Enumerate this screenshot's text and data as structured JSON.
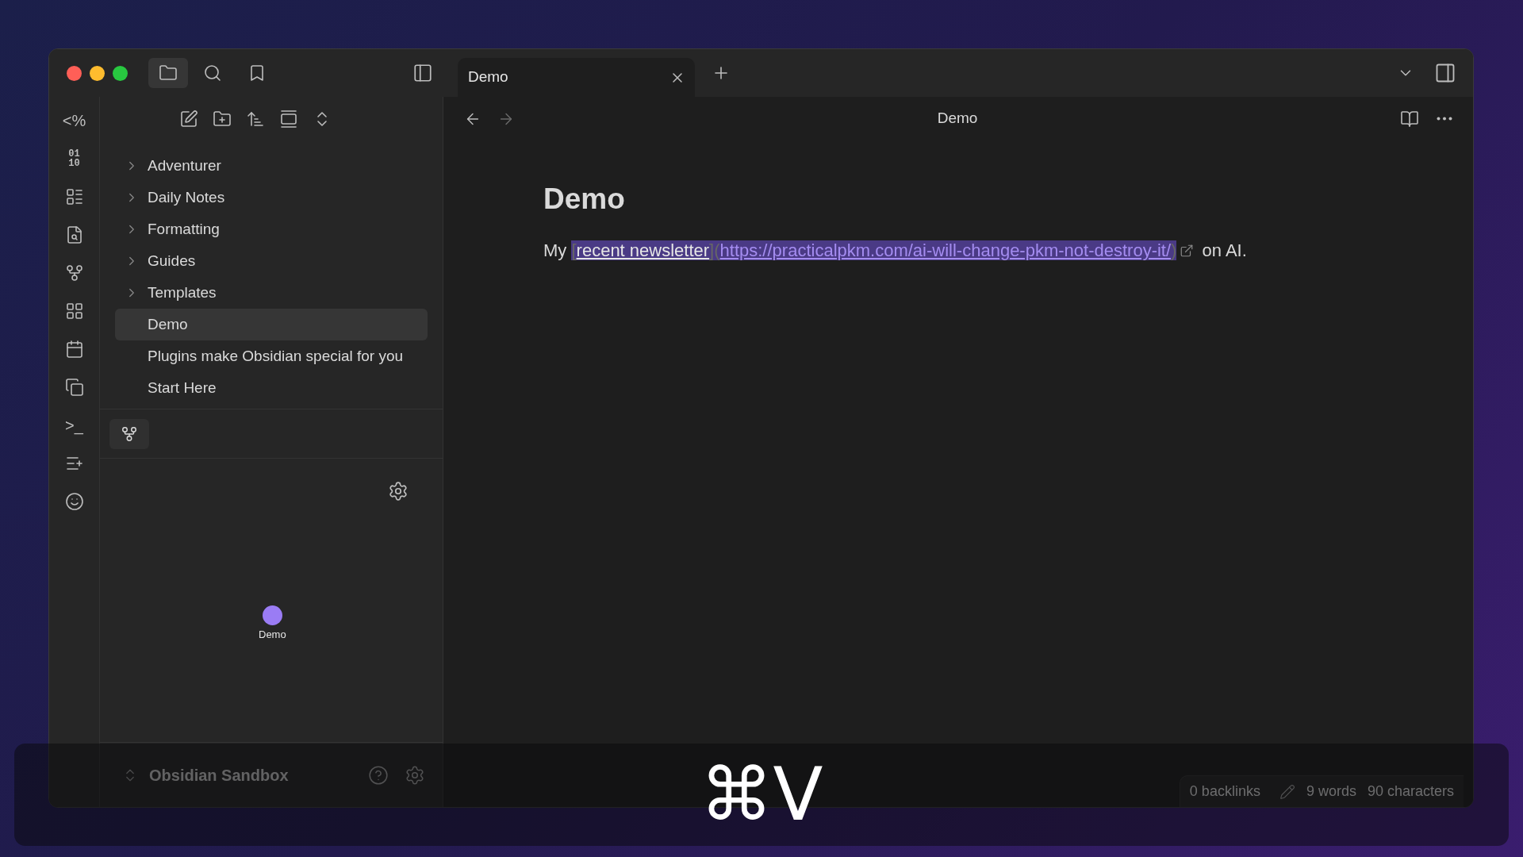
{
  "titlebar": {
    "nav_tabs": [
      {
        "kind": "files",
        "selected": true
      },
      {
        "kind": "search",
        "selected": false
      },
      {
        "kind": "bookmarks",
        "selected": false
      }
    ],
    "tabs": [
      {
        "label": "Demo",
        "selected": true
      }
    ]
  },
  "ribbon": [
    {
      "kind": "text",
      "text": "<%"
    },
    {
      "kind": "text",
      "lines": [
        "01",
        "10"
      ]
    },
    {
      "kind": "list"
    },
    {
      "kind": "doc-search"
    },
    {
      "kind": "graph"
    },
    {
      "kind": "grid"
    },
    {
      "kind": "calendar"
    },
    {
      "kind": "copy"
    },
    {
      "kind": "text",
      "text": ">_"
    },
    {
      "kind": "stack-add"
    },
    {
      "kind": "smile"
    }
  ],
  "file_tree": [
    {
      "label": "Adventurer",
      "kind": "folder",
      "selected": false
    },
    {
      "label": "Daily Notes",
      "kind": "folder",
      "selected": false
    },
    {
      "label": "Formatting",
      "kind": "folder",
      "selected": false
    },
    {
      "label": "Guides",
      "kind": "folder",
      "selected": false
    },
    {
      "label": "Templates",
      "kind": "folder",
      "selected": false
    },
    {
      "label": "Demo",
      "kind": "file",
      "selected": true
    },
    {
      "label": "Plugins make Obsidian special for you",
      "kind": "file",
      "selected": false
    },
    {
      "label": "Start Here",
      "kind": "file",
      "selected": false
    }
  ],
  "local_graph": {
    "nodes": [
      {
        "label": "Demo",
        "color": "#9a7cf4"
      }
    ]
  },
  "vault": {
    "name": "Obsidian Sandbox"
  },
  "editor": {
    "header_title": "Demo",
    "heading": "Demo",
    "paragraph": {
      "prefix": "My ",
      "open_bracket": "[",
      "link_text": "recent newsletter",
      "close_bracket": "]",
      "open_paren": "(",
      "url": "https://practicalpkm.com/ai-will-change-pkm-not-destroy-it/",
      "close_paren": ")",
      "suffix": " on AI.",
      "selected": true
    }
  },
  "status_bar": {
    "backlinks": "0 backlinks",
    "words": "9 words",
    "characters": "90 characters"
  },
  "key_overlay": {
    "keys": "⌘V"
  }
}
